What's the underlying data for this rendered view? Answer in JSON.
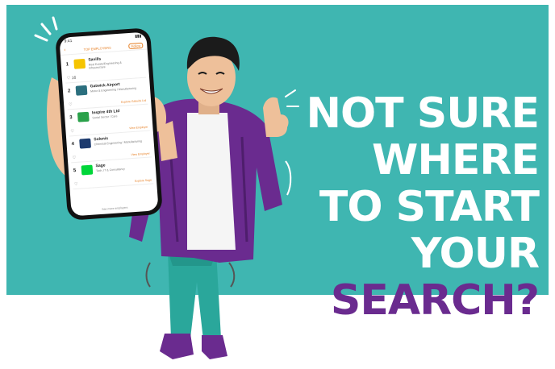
{
  "headline": {
    "lines": [
      "NOT SURE",
      "WHERE",
      "TO START",
      "YOUR",
      "SEARCH?"
    ]
  },
  "colors": {
    "teal": "#3fb6b1",
    "purple_shirt": "#6a2b8f",
    "pants": "#2aa79b",
    "accent_orange": "#e67e22"
  },
  "phone": {
    "status_time": "9:41",
    "appbar_title": "TOP EMPLOYERS",
    "appbar_button": "Follow",
    "items": [
      {
        "rank": "1",
        "name": "Savills",
        "sub": "Real Estate/Engineering & Infrastructure",
        "logo_color": "#f5c400",
        "likes": "16",
        "link": ""
      },
      {
        "rank": "2",
        "name": "Gatwick Airport",
        "sub": "Motor & Engineering / Manufacturing",
        "logo_color": "#2b6f7e",
        "likes": "",
        "link": "Explore Gatwick Ltd"
      },
      {
        "rank": "3",
        "name": "Inspire 4th Ltd",
        "sub": "Social Sector / Care",
        "logo_color": "#2aa14a",
        "likes": "",
        "link": "View Employer"
      },
      {
        "rank": "4",
        "name": "Solenis",
        "sub": "Chemical Engineering / Manufacturing",
        "logo_color": "#1c3a6e",
        "likes": "",
        "link": "View Employer"
      },
      {
        "rank": "5",
        "name": "Sage",
        "sub": "Tech, IT & Consultancy",
        "logo_color": "#00d639",
        "likes": "",
        "link": "Explore Sage"
      }
    ],
    "footer": "See more employers"
  }
}
